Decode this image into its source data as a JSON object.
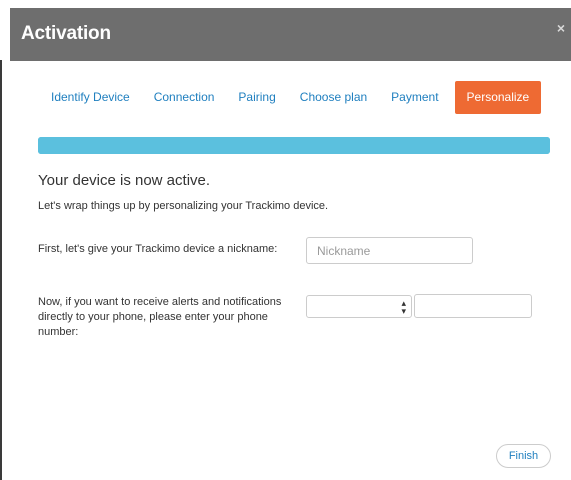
{
  "modal": {
    "title": "Activation",
    "close_glyph": "×",
    "close_icon": "close-icon"
  },
  "steps": [
    {
      "label": "Identify Device",
      "active": false
    },
    {
      "label": "Connection",
      "active": false
    },
    {
      "label": "Pairing",
      "active": false
    },
    {
      "label": "Choose plan",
      "active": false
    },
    {
      "label": "Payment",
      "active": false
    },
    {
      "label": "Personalize",
      "active": true
    }
  ],
  "progress": {
    "percent": 100,
    "color": "#5bc0de"
  },
  "content": {
    "heading": "Your device is now active.",
    "subtext": "Let's wrap things up by personalizing your Trackimo device."
  },
  "nickname": {
    "label": "First, let's give your Trackimo device a nickname:",
    "placeholder": "Nickname",
    "value": ""
  },
  "phone": {
    "label": "Now, if you want to receive alerts and notifications directly to your phone, please enter your phone number:",
    "country_code_selected": "",
    "number_value": ""
  },
  "footer": {
    "finish_label": "Finish"
  },
  "colors": {
    "header_bg": "#6e6e6e",
    "accent_orange": "#ee6a33",
    "link_blue": "#1f7fbf"
  }
}
